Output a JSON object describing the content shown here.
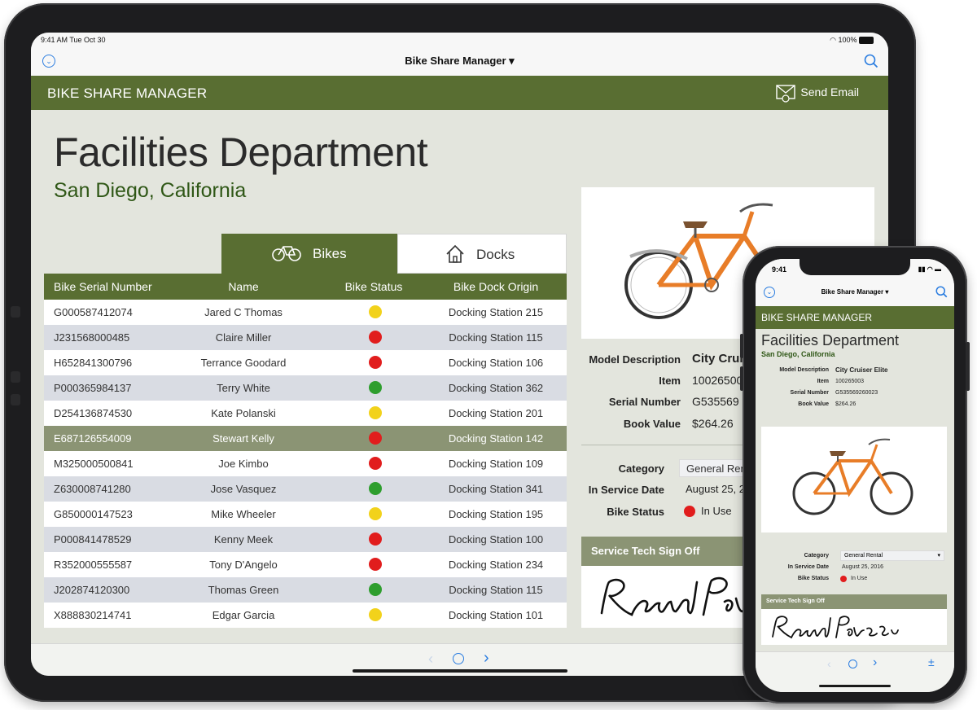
{
  "ipad": {
    "status": {
      "time": "9:41 AM  Tue Oct 30",
      "battery": "100%"
    },
    "nav": {
      "title": "Bike Share Manager ▾"
    },
    "header": {
      "app_name": "BIKE SHARE MANAGER",
      "send_email": "Send Email"
    },
    "page_title": "Facilities Department",
    "page_subtitle": "San Diego, California",
    "tabs": [
      {
        "label": "Bikes",
        "active": true
      },
      {
        "label": "Docks",
        "active": false
      }
    ],
    "table": {
      "columns": [
        "Bike Serial Number",
        "Name",
        "Bike Status",
        "Bike Dock Origin"
      ],
      "rows": [
        {
          "serial": "G000587412074",
          "name": "Jared C Thomas",
          "status": "yellow",
          "dock": "Docking Station 215"
        },
        {
          "serial": "J231568000485",
          "name": "Claire Miller",
          "status": "red",
          "dock": "Docking Station 115"
        },
        {
          "serial": "H652841300796",
          "name": "Terrance Goodard",
          "status": "red",
          "dock": "Docking Station 106"
        },
        {
          "serial": "P000365984137",
          "name": "Terry White",
          "status": "green",
          "dock": "Docking Station 362"
        },
        {
          "serial": "D254136874530",
          "name": "Kate Polanski",
          "status": "yellow",
          "dock": "Docking Station 201"
        },
        {
          "serial": "E687126554009",
          "name": "Stewart Kelly",
          "status": "red",
          "dock": "Docking Station 142",
          "selected": true
        },
        {
          "serial": "M325000500841",
          "name": "Joe Kimbo",
          "status": "red",
          "dock": "Docking Station 109"
        },
        {
          "serial": "Z630008741280",
          "name": "Jose Vasquez",
          "status": "green",
          "dock": "Docking Station 341"
        },
        {
          "serial": "G850000147523",
          "name": "Mike Wheeler",
          "status": "yellow",
          "dock": "Docking Station 195"
        },
        {
          "serial": "P000841478529",
          "name": "Kenny Meek",
          "status": "red",
          "dock": "Docking Station 100"
        },
        {
          "serial": "R352000555587",
          "name": "Tony D'Angelo",
          "status": "red",
          "dock": "Docking Station 234"
        },
        {
          "serial": "J202874120300",
          "name": "Thomas Green",
          "status": "green",
          "dock": "Docking Station 115"
        },
        {
          "serial": "X888830214741",
          "name": "Edgar Garcia",
          "status": "yellow",
          "dock": "Docking Station 101"
        }
      ]
    },
    "details": {
      "model_label": "Model Description",
      "model_value": "City Cruis",
      "item_label": "Item",
      "item_value": "100265003",
      "serial_label": "Serial Number",
      "serial_value": "G535569",
      "book_label": "Book Value",
      "book_value": "$264.26",
      "category_label": "Category",
      "category_value": "General Rent",
      "service_label": "In Service Date",
      "service_value": "August 25, 2",
      "status_label": "Bike Status",
      "status_value": "In Use"
    },
    "tech_signoff": "Service Tech Sign Off",
    "signature": "Rand Parsons"
  },
  "iphone": {
    "status": {
      "time": "9:41"
    },
    "nav": {
      "title": "Bike Share Manager ▾"
    },
    "header": {
      "app_name": "BIKE SHARE MANAGER"
    },
    "page_title": "Facilities Department",
    "page_subtitle": "San Diego, California",
    "details": {
      "model_label": "Model Description",
      "model_value": "City Cruiser Elite",
      "item_label": "Item",
      "item_value": "100265003",
      "serial_label": "Serial Number",
      "serial_value": "G535569260023",
      "book_label": "Book Value",
      "book_value": "$264.26",
      "category_label": "Category",
      "category_value": "General Rental",
      "service_label": "In Service Date",
      "service_value": "August 25, 2016",
      "status_label": "Bike Status",
      "status_value": "In Use"
    },
    "tech_signoff": "Service Tech Sign Off",
    "signature": "Rand Parsons"
  },
  "colors": {
    "brand_green": "#596e32",
    "dark_green_text": "#2f5716",
    "status_red": "#e11d1d",
    "status_yellow": "#f2d21b",
    "status_green": "#2e9e2e",
    "selected_row": "#8b9474"
  }
}
